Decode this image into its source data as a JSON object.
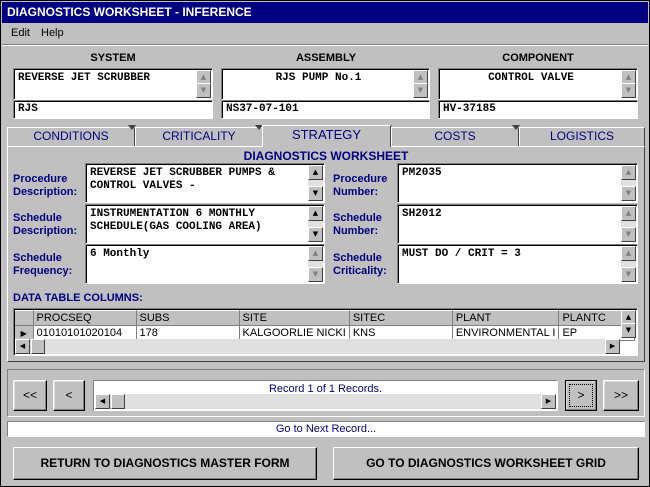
{
  "window": {
    "title": "DIAGNOSTICS WORKSHEET - INFERENCE"
  },
  "menu": {
    "edit": "Edit",
    "help": "Help"
  },
  "header": {
    "system_label": "SYSTEM",
    "assembly_label": "ASSEMBLY",
    "component_label": "COMPONENT",
    "system_name": "REVERSE JET SCRUBBER",
    "assembly_name": "RJS PUMP No.1",
    "component_name": "CONTROL VALVE",
    "system_code": "RJS",
    "assembly_code": "NS37-07-101",
    "component_code": "HV-37185"
  },
  "tabs": [
    {
      "label": "CONDITIONS"
    },
    {
      "label": "CRITICALITY"
    },
    {
      "label": "STRATEGY"
    },
    {
      "label": "COSTS"
    },
    {
      "label": "LOGISTICS"
    }
  ],
  "worksheet": {
    "title": "DIAGNOSTICS WORKSHEET",
    "procedure_description_label": "Procedure Description:",
    "procedure_description": "REVERSE JET SCRUBBER PUMPS & CONTROL VALVES -",
    "procedure_number_label": "Procedure Number:",
    "procedure_number": "PM2035",
    "schedule_description_label": "Schedule Description:",
    "schedule_description": "INSTRUMENTATION 6 MONTHLY SCHEDULE(GAS COOLING AREA)",
    "schedule_number_label": "Schedule Number:",
    "schedule_number": "SH2012",
    "schedule_frequency_label": "Schedule Frequency:",
    "schedule_frequency": "6 Monthly",
    "schedule_criticality_label": "Schedule Criticality:",
    "schedule_criticality": "MUST DO / CRIT = 3",
    "data_table_label": "DATA TABLE COLUMNS:"
  },
  "grid": {
    "columns": [
      "PROCSEQ",
      "SUBS",
      "SITE",
      "SITEC",
      "PLANT",
      "PLANTC"
    ],
    "row": [
      "01010101020104",
      "178",
      "KALGOORLIE NICKI",
      "KNS",
      "ENVIRONMENTAL I",
      "EP"
    ]
  },
  "navigation": {
    "first": "<<",
    "prev": "<",
    "next": ">",
    "last": ">>",
    "record_text": "Record 1 of 1 Records."
  },
  "status": {
    "text": "Go to Next Record..."
  },
  "footer": {
    "return_button": "RETURN TO DIAGNOSTICS MASTER FORM",
    "goto_button": "GO TO DIAGNOSTICS WORKSHEET GRID"
  }
}
